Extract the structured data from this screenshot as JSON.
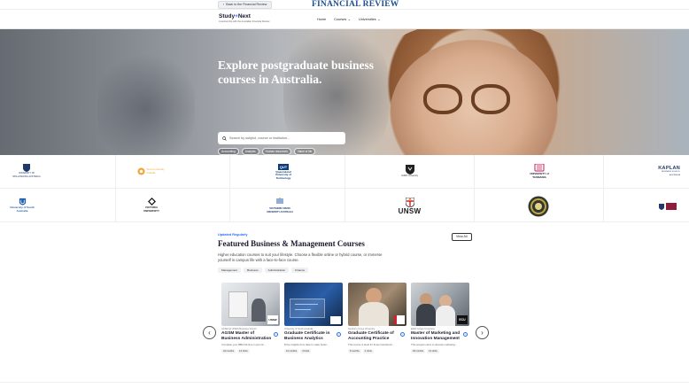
{
  "topbar": {
    "back_label": "Back to the Financial Review",
    "masthead": "FINANCIAL REVIEW"
  },
  "nav": {
    "brand_name_a": "Study",
    "brand_name_b": "Next",
    "brand_sub": "A partnership with the Australian Financial Review",
    "links": [
      {
        "label": "Home"
      },
      {
        "label": "Courses"
      },
      {
        "label": "Universities"
      }
    ]
  },
  "hero": {
    "title": "Explore postgraduate business courses in Australia.",
    "search_placeholder": "Search by subject, course or institution...",
    "chips": [
      "Accounting",
      "Analysis",
      "Human resources",
      "Value of life"
    ]
  },
  "logos": {
    "row1": [
      {
        "name": "University of Wollongong Australia"
      },
      {
        "name": "Torrens University Australia"
      },
      {
        "name": "Queensland University of Technology"
      },
      {
        "name": "Griffith University"
      },
      {
        "name": "University of Tasmania"
      },
      {
        "name": "Kaplan Business School Australia"
      }
    ],
    "row2": [
      {
        "name": "University of South Australia"
      },
      {
        "name": "Victoria University"
      },
      {
        "name": "Southern Cross University Australia"
      },
      {
        "name": "UNSW"
      },
      {
        "name": "University seal"
      },
      {
        "name": "University crest"
      }
    ],
    "text": {
      "qut": "QUT",
      "qut_full": "Queensland University of Technology",
      "tas": "UNIVERSITY of TASMANIA",
      "kaplan": "KAPLAN",
      "kaplan_sub": "BUSINESS SCHOOL AUSTRALIA",
      "unisa": "University of South Australia",
      "vu": "VICTORIA UNIVERSITY",
      "scu": "SOUTHERN CROSS UNIVERSITY AUSTRALIA",
      "unsw": "UNSW",
      "uow": "UNIVERSITY OF WOLLONGONG AUSTRALIA",
      "torrens": "Torrens University Australia",
      "griffith": "Griffith University"
    }
  },
  "featured": {
    "eyebrow": "Updated Regularly",
    "title": "Featured Business & Management Courses",
    "description": "Higher education courses to suit your lifestyle. Choose a flexible online or hybrid course, or immerse yourself in campus life with a face-to-face course.",
    "view_all": "View All",
    "tabs": [
      "Management",
      "Business",
      "Administration",
      "Finance"
    ],
    "courses": [
      {
        "provider": "AGSM @ UNSW Business School",
        "title": "AGSM Master of Business Administration",
        "desc": "Complete your MBA full-time in just 12...",
        "duration": "24 months",
        "credits": "12 Units"
      },
      {
        "provider": "University of South Australia",
        "title": "Graduate Certificate in Business Analytics",
        "desc": "Drive insights from data to make better...",
        "duration": "12 months",
        "credits": "4 Units"
      },
      {
        "provider": "Southern Cross University",
        "title": "Graduate Certificate of Accounting Practice",
        "desc": "This course is ideal for those transitionin...",
        "duration": "8 months",
        "credits": "4 Units"
      },
      {
        "provider": "Edith Cowan University",
        "title": "Master of Marketing and Innovation Management",
        "desc": "This program aims to develop marketing...",
        "duration": "18 months",
        "credits": "12 Units"
      }
    ]
  },
  "colors": {
    "accent": "#2a6ef2",
    "masthead": "#1d4f91",
    "ink": "#1a1a2e"
  }
}
